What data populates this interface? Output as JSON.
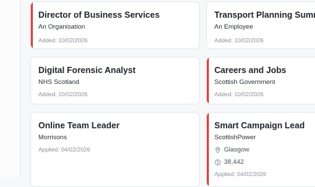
{
  "cards": [
    {
      "title": "Director of Business Services",
      "org": "An Organisation",
      "meta": "Added: 10/02/2026"
    },
    {
      "title": "Transport Planning Summer",
      "org": "An Employee",
      "meta": "Added: 10/02/2026"
    },
    {
      "title": "Digital Forensic Analyst",
      "org": "NHS Scotland",
      "meta": "Added: 10/02/2026"
    },
    {
      "title": "Careers and Jobs",
      "org": "Scottish Government",
      "meta": "Added: 10/02/2026"
    },
    {
      "title": "Online Team Leader",
      "org": "Morrisons",
      "meta": "Applied: 04/02/2026"
    },
    {
      "title": "Smart Campaign Lead",
      "org": "ScottishPower",
      "location": "Glasgow",
      "salary": "38,442",
      "meta": "Applied: 04/02/2026"
    }
  ],
  "colors": {
    "accent": "#e0433f"
  },
  "icons": {
    "location": "map-pin-icon",
    "salary": "currency-icon"
  }
}
